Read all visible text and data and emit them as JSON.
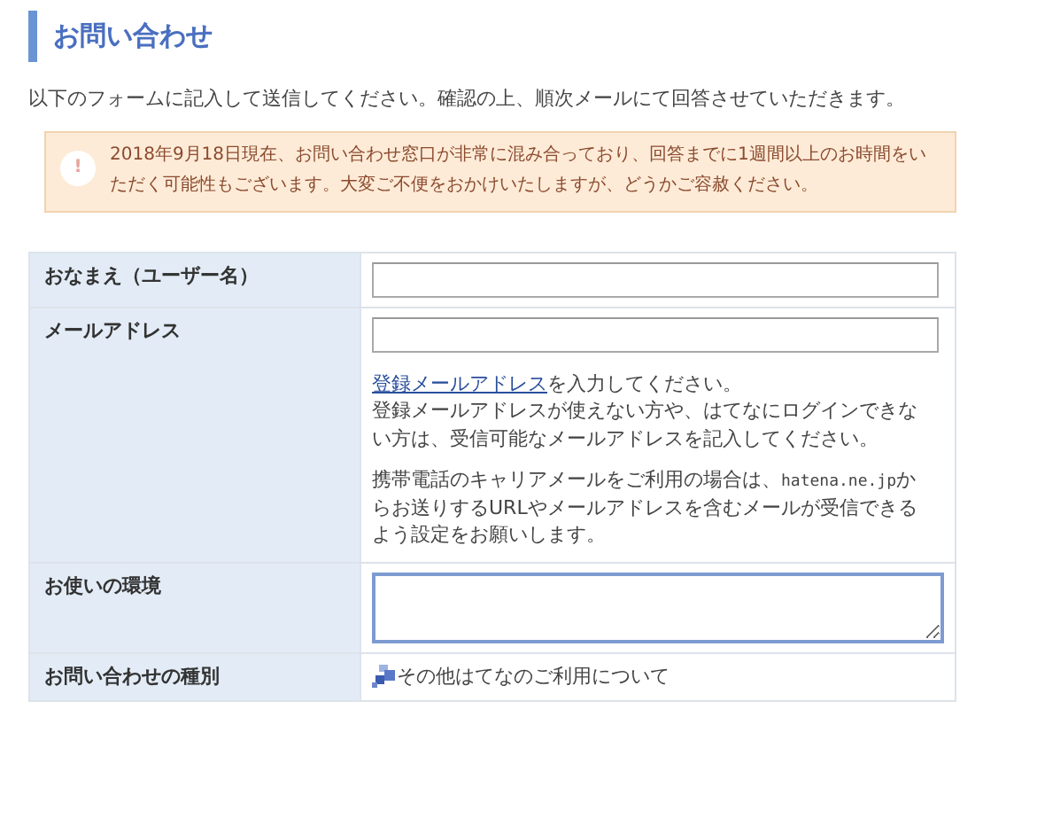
{
  "heading": "お問い合わせ",
  "intro": "以下のフォームに記入して送信してください。確認の上、順次メールにて回答させていただきます。",
  "notice": {
    "icon": "!",
    "text": "2018年9月18日現在、お問い合わせ窓口が非常に混み合っており、回答までに1週間以上のお時間をいただく可能性もございます。大変ご不便をおかけいたしますが、どうかご容赦ください。"
  },
  "form": [
    {
      "kind": "input",
      "label": "おなまえ（ユーザー名）"
    },
    {
      "kind": "input",
      "label": "メールアドレス",
      "help": {
        "link": "登録メールアドレス",
        "after_link": "を入力してください。",
        "paragraph": "登録メールアドレスが使えない方や、はてなにログインできない方は、受信可能なメールアドレスを記入してください。",
        "mobile_before": "携帯電話のキャリアメールをご利用の場合は、",
        "domain": "hatena.ne.jp",
        "mobile_after": "からお送りするURLやメールアドレスを含むメールが受信できるよう設定をお願いします。"
      }
    },
    {
      "kind": "textarea",
      "label": "お使いの環境",
      "focused": true
    },
    {
      "kind": "select",
      "label": "お問い合わせの種別",
      "value": "その他はてなのご利用について"
    }
  ]
}
